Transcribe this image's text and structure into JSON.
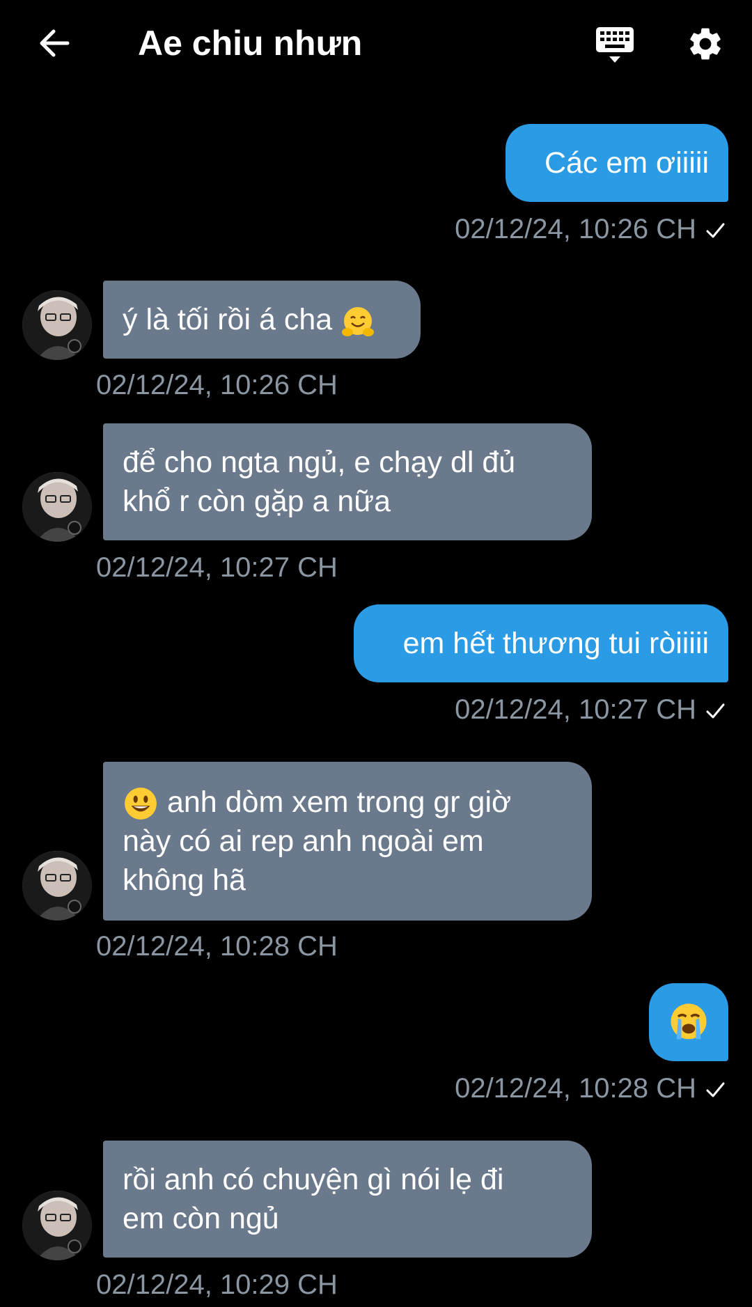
{
  "header": {
    "title": "Ae chiu nhưn"
  },
  "colors": {
    "outgoing_bubble": "#2b9be6",
    "incoming_bubble": "#6a7a8c",
    "timestamp": "#8b96a3",
    "background": "#000000"
  },
  "messages": [
    {
      "direction": "out",
      "lines": [
        "Các em ơiiiii"
      ],
      "timestamp": "02/12/24, 10:26 CH",
      "read": true
    },
    {
      "direction": "in",
      "lines": [
        "ý là tối rồi á cha"
      ],
      "emoji": "hugging-face-emoji",
      "timestamp": "02/12/24, 10:26 CH"
    },
    {
      "direction": "in",
      "lines": [
        "để cho ngta ngủ, e chạy dl đủ",
        "khổ r còn gặp a nữa"
      ],
      "timestamp": "02/12/24, 10:27 CH"
    },
    {
      "direction": "out",
      "lines": [
        "em hết thương tui ròiiiii"
      ],
      "timestamp": "02/12/24, 10:27 CH",
      "read": true
    },
    {
      "direction": "in",
      "lines": [
        "anh dòm xem trong gr giờ",
        "này có ai rep anh ngoài em",
        "không hã"
      ],
      "emoji": "grinning-face-emoji",
      "timestamp": "02/12/24, 10:28 CH"
    },
    {
      "direction": "out",
      "lines": [
        ""
      ],
      "emoji": "loudly-crying-face-emoji",
      "timestamp": "02/12/24, 10:28 CH",
      "read": true
    },
    {
      "direction": "in",
      "lines": [
        "rồi anh có chuyện gì nói lẹ đi",
        "em còn ngủ"
      ],
      "timestamp": "02/12/24, 10:29 CH"
    }
  ]
}
